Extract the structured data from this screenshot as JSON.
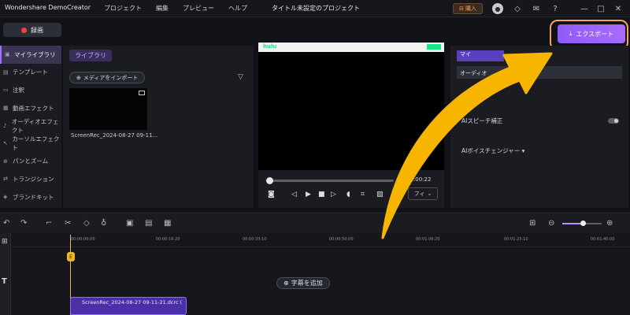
{
  "app": {
    "title": "Wondershare DemoCreator",
    "menu": [
      "プロジェクト",
      "編集",
      "プレビュー",
      "ヘルプ"
    ],
    "project_title": "タイトル未設定のプロジェクト",
    "buy_label": "購入"
  },
  "toolbar": {
    "record_label": "録画",
    "export_label": "エクスポート"
  },
  "sidebar": {
    "items": [
      {
        "label": "マイライブラリ",
        "icon": "folder-icon",
        "active": true
      },
      {
        "label": "テンプレート",
        "icon": "template-icon"
      },
      {
        "label": "注釈",
        "icon": "annotation-icon"
      },
      {
        "label": "動画エフェクト",
        "icon": "video-effect-icon"
      },
      {
        "label": "オーディオエフェクト",
        "icon": "audio-effect-icon"
      },
      {
        "label": "カーソルエフェクト",
        "icon": "cursor-effect-icon"
      },
      {
        "label": "パンとズーム",
        "icon": "pan-zoom-icon"
      },
      {
        "label": "トランジション",
        "icon": "transition-icon"
      },
      {
        "label": "ブランドキット",
        "icon": "brand-kit-icon"
      }
    ]
  },
  "library": {
    "tab_label": "ライブラリ",
    "import_label": "メディアをインポート",
    "media_name": "ScreenRec_2024-08-27 09-11..."
  },
  "preview": {
    "site_logo": "hulu",
    "time": "00:00:22",
    "fit_label": "フィ"
  },
  "right_panel": {
    "tab_label": "マイ",
    "section_label": "オーディオ",
    "ai_speech": "AIスピーチ補正",
    "ai_voice": "AIボイスチェンジャー"
  },
  "timeline": {
    "ruler_labels": [
      "00:00:00:00",
      "00:00:16:20",
      "00:00:33:10",
      "00:00:50:00",
      "00:01:06:20",
      "00:01:23:10",
      "00:01:40:00"
    ],
    "caption_label": "字幕を追加",
    "clip_label": "ScreenRec_2024-08-27 09-11-21.dcrc (",
    "playhead_tag": "E",
    "zoom_level": 0.5
  },
  "colors": {
    "accent": "#a070ff",
    "export_highlight": "#f7a35c",
    "arrow": "#f7b500",
    "record": "#ff3b44"
  }
}
